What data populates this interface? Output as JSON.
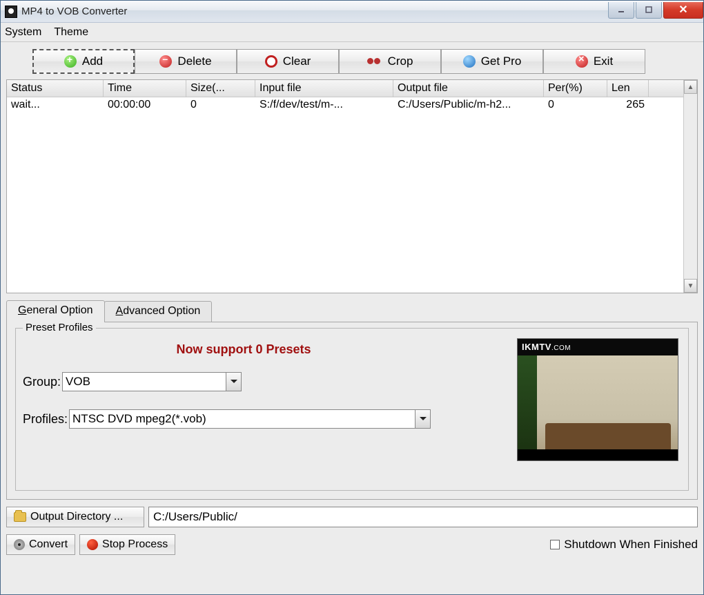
{
  "window": {
    "title": "MP4 to VOB Converter"
  },
  "menu": {
    "system": "System",
    "theme": "Theme"
  },
  "toolbar": {
    "add": "Add",
    "delete": "Delete",
    "clear": "Clear",
    "crop": "Crop",
    "getpro": "Get Pro",
    "exit": "Exit"
  },
  "table": {
    "headers": {
      "status": "Status",
      "time": "Time",
      "size": "Size(...",
      "input": "Input file",
      "output": "Output file",
      "per": "Per(%)",
      "len": "Len"
    },
    "rows": [
      {
        "status": "wait...",
        "time": "00:00:00",
        "size": "0",
        "input": "S:/f/dev/test/m-...",
        "output": "C:/Users/Public/m-h2...",
        "per": "0",
        "len": "265"
      }
    ]
  },
  "tabs": {
    "general": "General Option",
    "advanced": "Advanced Option"
  },
  "preset": {
    "legend": "Preset Profiles",
    "message": "Now support 0 Presets",
    "group_label": "Group:",
    "group_value": "VOB",
    "profiles_label": "Profiles:",
    "profiles_value": "NTSC DVD mpeg2(*.vob)"
  },
  "preview": {
    "brand": "IKMTV",
    "tld": ".COM"
  },
  "output": {
    "button": "Output Directory ...",
    "path": "C:/Users/Public/"
  },
  "actions": {
    "convert": "Convert",
    "stop": "Stop Process"
  },
  "shutdown": {
    "label": "Shutdown When Finished"
  }
}
